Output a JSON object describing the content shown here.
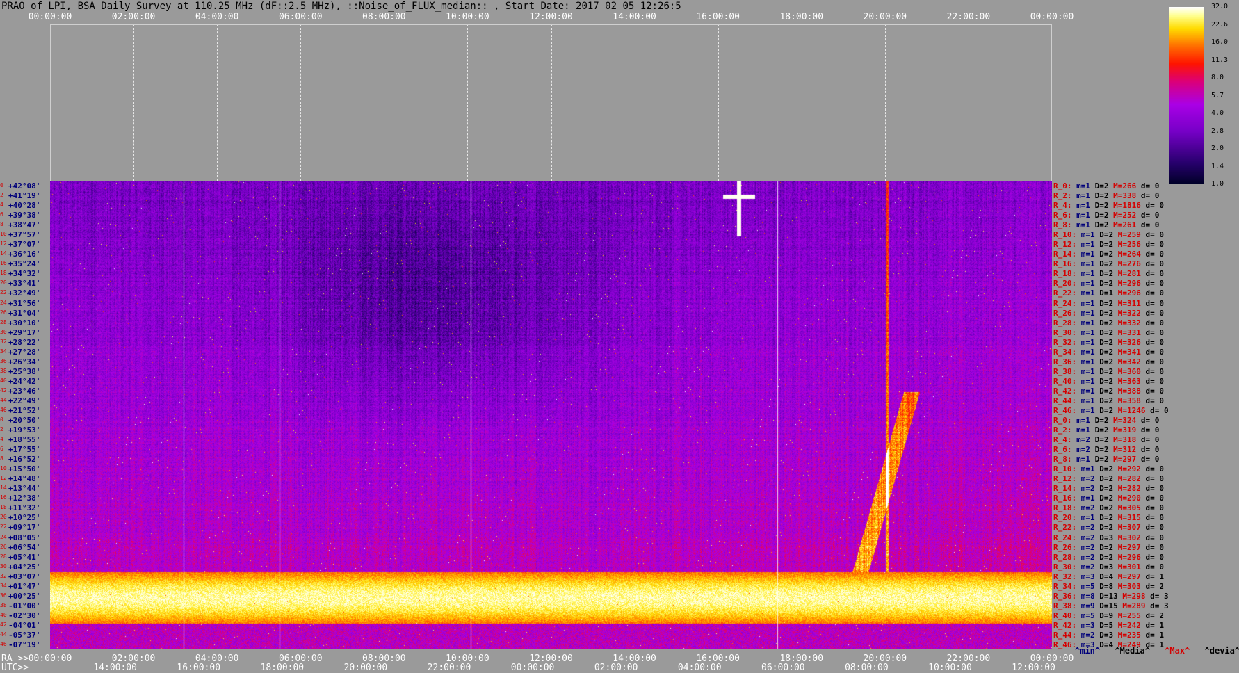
{
  "title": "PRAO of LPI, BSA Daily Survey at 110.25 MHz (dF::2.5 MHz), ::Noise_of_FLUX_median:: , Start Date: 2017 02 05 12:26:5",
  "top_ticks": [
    "00:00:00",
    "02:00:00",
    "04:00:00",
    "06:00:00",
    "08:00:00",
    "10:00:00",
    "12:00:00",
    "14:00:00",
    "16:00:00",
    "18:00:00",
    "20:00:00",
    "22:00:00",
    "00:00:00"
  ],
  "ra_label": "RA >>",
  "ra_ticks": [
    "00:00:00",
    "02:00:00",
    "04:00:00",
    "06:00:00",
    "08:00:00",
    "10:00:00",
    "12:00:00",
    "14:00:00",
    "16:00:00",
    "18:00:00",
    "20:00:00",
    "22:00:00",
    "00:00:00"
  ],
  "utc_label": "UTC>>",
  "utc_ticks": [
    "14:00:00",
    "16:00:00",
    "18:00:00",
    "20:00:00",
    "22:00:00",
    "00:00:00",
    "02:00:00",
    "04:00:00",
    "06:00:00",
    "08:00:00",
    "10:00:00",
    "12:00:00"
  ],
  "declinations": [
    "+42°08'",
    "+41°19'",
    "+40°28'",
    "+39°38'",
    "+38°47'",
    "+37°57'",
    "+37°07'",
    "+36°16'",
    "+35°24'",
    "+34°32'",
    "+33°41'",
    "+32°49'",
    "+31°56'",
    "+31°04'",
    "+30°10'",
    "+29°17'",
    "+28°22'",
    "+27°28'",
    "+26°34'",
    "+25°38'",
    "+24°42'",
    "+23°46'",
    "+22°49'",
    "+21°52'",
    "+20°50'",
    "+19°53'",
    "+18°55'",
    "+17°55'",
    "+16°52'",
    "+15°50'",
    "+14°48'",
    "+13°44'",
    "+12°38'",
    "+11°32'",
    "+10°25'",
    "+09°17'",
    "+08°05'",
    "+06°54'",
    "+05°41'",
    "+04°25'",
    "+03°07'",
    "+01°47'",
    "+00°25'",
    "-01°00'",
    "-02°30'",
    "-04°01'",
    "-05°37'",
    "-07°19'"
  ],
  "row_indices": [
    "0",
    "2",
    "4",
    "6",
    "8",
    "10",
    "12",
    "14",
    "16",
    "18",
    "20",
    "22",
    "24",
    "26",
    "28",
    "30",
    "32",
    "34",
    "36",
    "38",
    "40",
    "42",
    "44",
    "46",
    "0",
    "2",
    "4",
    "6",
    "8",
    "10",
    "12",
    "14",
    "16",
    "18",
    "20",
    "22",
    "24",
    "26",
    "28",
    "30",
    "32",
    "34",
    "36",
    "38",
    "40",
    "42",
    "44",
    "46"
  ],
  "stats": [
    {
      "label": "R_0:",
      "m": "m=1",
      "D": "D=2",
      "M": "M=266",
      "d": "d= 0"
    },
    {
      "label": "R_2:",
      "m": "m=1",
      "D": "D=2",
      "M": "M=338",
      "d": "d= 0"
    },
    {
      "label": "R_4:",
      "m": "m=1",
      "D": "D=2",
      "M": "M=1816",
      "d": "d= 0"
    },
    {
      "label": "R_6:",
      "m": "m=1",
      "D": "D=2",
      "M": "M=252",
      "d": "d= 0"
    },
    {
      "label": "R_8:",
      "m": "m=1",
      "D": "D=2",
      "M": "M=261",
      "d": "d= 0"
    },
    {
      "label": "R_10:",
      "m": "m=1",
      "D": "D=2",
      "M": "M=259",
      "d": "d= 0"
    },
    {
      "label": "R_12:",
      "m": "m=1",
      "D": "D=2",
      "M": "M=256",
      "d": "d= 0"
    },
    {
      "label": "R_14:",
      "m": "m=1",
      "D": "D=2",
      "M": "M=264",
      "d": "d= 0"
    },
    {
      "label": "R_16:",
      "m": "m=1",
      "D": "D=2",
      "M": "M=276",
      "d": "d= 0"
    },
    {
      "label": "R_18:",
      "m": "m=1",
      "D": "D=2",
      "M": "M=281",
      "d": "d= 0"
    },
    {
      "label": "R_20:",
      "m": "m=1",
      "D": "D=2",
      "M": "M=296",
      "d": "d= 0"
    },
    {
      "label": "R_22:",
      "m": "m=1",
      "D": "D=1",
      "M": "M=296",
      "d": "d= 0"
    },
    {
      "label": "R_24:",
      "m": "m=1",
      "D": "D=2",
      "M": "M=311",
      "d": "d= 0"
    },
    {
      "label": "R_26:",
      "m": "m=1",
      "D": "D=2",
      "M": "M=322",
      "d": "d= 0"
    },
    {
      "label": "R_28:",
      "m": "m=1",
      "D": "D=2",
      "M": "M=332",
      "d": "d= 0"
    },
    {
      "label": "R_30:",
      "m": "m=1",
      "D": "D=2",
      "M": "M=331",
      "d": "d= 0"
    },
    {
      "label": "R_32:",
      "m": "m=1",
      "D": "D=2",
      "M": "M=326",
      "d": "d= 0"
    },
    {
      "label": "R_34:",
      "m": "m=1",
      "D": "D=2",
      "M": "M=341",
      "d": "d= 0"
    },
    {
      "label": "R_36:",
      "m": "m=1",
      "D": "D=2",
      "M": "M=342",
      "d": "d= 0"
    },
    {
      "label": "R_38:",
      "m": "m=1",
      "D": "D=2",
      "M": "M=360",
      "d": "d= 0"
    },
    {
      "label": "R_40:",
      "m": "m=1",
      "D": "D=2",
      "M": "M=363",
      "d": "d= 0"
    },
    {
      "label": "R_42:",
      "m": "m=1",
      "D": "D=2",
      "M": "M=388",
      "d": "d= 0"
    },
    {
      "label": "R_44:",
      "m": "m=1",
      "D": "D=2",
      "M": "M=358",
      "d": "d= 0"
    },
    {
      "label": "R_46:",
      "m": "m=1",
      "D": "D=2",
      "M": "M=1246",
      "d": "d= 0"
    },
    {
      "label": "R_0:",
      "m": "m=1",
      "D": "D=2",
      "M": "M=324",
      "d": "d= 0"
    },
    {
      "label": "R_2:",
      "m": "m=1",
      "D": "D=2",
      "M": "M=319",
      "d": "d= 0"
    },
    {
      "label": "R_4:",
      "m": "m=2",
      "D": "D=2",
      "M": "M=318",
      "d": "d= 0"
    },
    {
      "label": "R_6:",
      "m": "m=2",
      "D": "D=2",
      "M": "M=312",
      "d": "d= 0"
    },
    {
      "label": "R_8:",
      "m": "m=1",
      "D": "D=2",
      "M": "M=297",
      "d": "d= 0"
    },
    {
      "label": "R_10:",
      "m": "m=1",
      "D": "D=2",
      "M": "M=292",
      "d": "d= 0"
    },
    {
      "label": "R_12:",
      "m": "m=2",
      "D": "D=2",
      "M": "M=282",
      "d": "d= 0"
    },
    {
      "label": "R_14:",
      "m": "m=2",
      "D": "D=2",
      "M": "M=282",
      "d": "d= 0"
    },
    {
      "label": "R_16:",
      "m": "m=1",
      "D": "D=2",
      "M": "M=290",
      "d": "d= 0"
    },
    {
      "label": "R_18:",
      "m": "m=2",
      "D": "D=2",
      "M": "M=305",
      "d": "d= 0"
    },
    {
      "label": "R_20:",
      "m": "m=1",
      "D": "D=2",
      "M": "M=315",
      "d": "d= 0"
    },
    {
      "label": "R_22:",
      "m": "m=2",
      "D": "D=2",
      "M": "M=307",
      "d": "d= 0"
    },
    {
      "label": "R_24:",
      "m": "m=2",
      "D": "D=3",
      "M": "M=302",
      "d": "d= 0"
    },
    {
      "label": "R_26:",
      "m": "m=2",
      "D": "D=2",
      "M": "M=297",
      "d": "d= 0"
    },
    {
      "label": "R_28:",
      "m": "m=2",
      "D": "D=2",
      "M": "M=296",
      "d": "d= 0"
    },
    {
      "label": "R_30:",
      "m": "m=2",
      "D": "D=3",
      "M": "M=301",
      "d": "d= 0"
    },
    {
      "label": "R_32:",
      "m": "m=3",
      "D": "D=4",
      "M": "M=297",
      "d": "d= 1"
    },
    {
      "label": "R_34:",
      "m": "m=5",
      "D": "D=8",
      "M": "M=303",
      "d": "d= 2"
    },
    {
      "label": "R_36:",
      "m": "m=8",
      "D": "D=13",
      "M": "M=298",
      "d": "d= 3"
    },
    {
      "label": "R_38:",
      "m": "m=9",
      "D": "D=15",
      "M": "M=289",
      "d": "d= 3"
    },
    {
      "label": "R_40:",
      "m": "m=5",
      "D": "D=9",
      "M": "M=255",
      "d": "d= 2"
    },
    {
      "label": "R_42:",
      "m": "m=3",
      "D": "D=5",
      "M": "M=242",
      "d": "d= 1"
    },
    {
      "label": "R_44:",
      "m": "m=2",
      "D": "D=3",
      "M": "M=235",
      "d": "d= 1"
    },
    {
      "label": "R_46:",
      "m": "m=3",
      "D": "D=4",
      "M": "M=249",
      "d": "d= 1"
    }
  ],
  "legend": {
    "min": "^min^",
    "media": "^Media^",
    "max": "^Max^",
    "devia": "^devia^"
  },
  "colorbar_ticks": [
    "32.0",
    "22.6",
    "16.0",
    "11.3",
    "8.0",
    "5.7",
    "4.0",
    "2.8",
    "2.0",
    "1.4",
    "1.0"
  ],
  "colors": {
    "background": "#9a9a9a",
    "index_red": "#d40000",
    "dec_blue": "#00007a"
  }
}
